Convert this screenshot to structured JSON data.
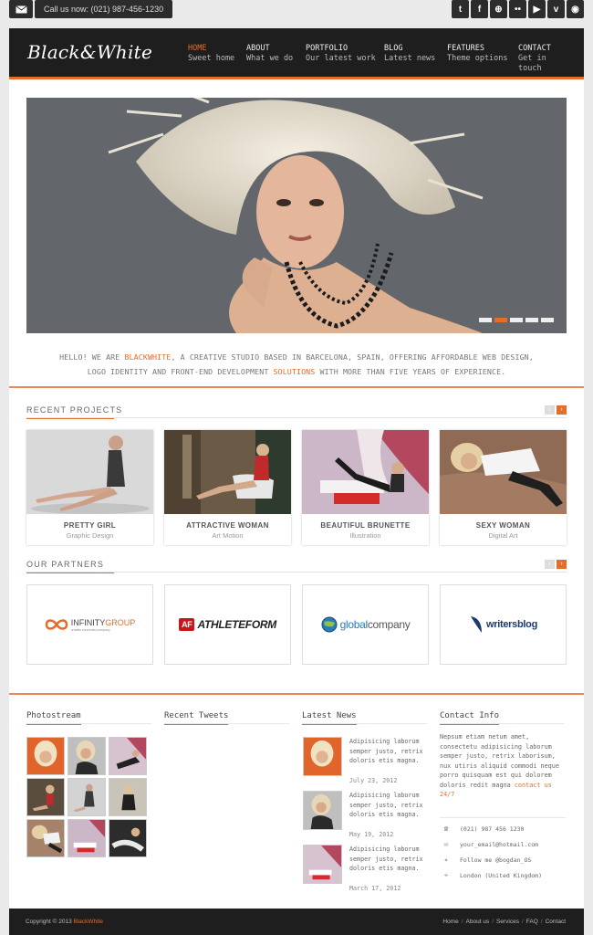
{
  "topbar": {
    "call_text": "Call us now: (021) 987-456-1230",
    "social_icons": [
      "twitter-icon",
      "facebook-icon",
      "dribbble-icon",
      "flickr-icon",
      "youtube-icon",
      "vimeo-icon",
      "rss-icon"
    ],
    "social_glyphs": [
      "t",
      "f",
      "⊕",
      "••",
      "▶",
      "v",
      "◉"
    ]
  },
  "header": {
    "logo": "Black&White",
    "nav": [
      {
        "title": "HOME",
        "subtitle": "Sweet home",
        "active": true
      },
      {
        "title": "ABOUT",
        "subtitle": "What we do"
      },
      {
        "title": "PORTFOLIO",
        "subtitle": "Our latest work"
      },
      {
        "title": "BLOG",
        "subtitle": "Latest news"
      },
      {
        "title": "FEATURES",
        "subtitle": "Theme options"
      },
      {
        "title": "CONTACT",
        "subtitle": "Get in touch"
      }
    ]
  },
  "intro": {
    "p1": "HELLO! WE ARE ",
    "brand": "BLACKWHITE",
    "p2": ", A CREATIVE STUDIO BASED IN BARCELONA, SPAIN, OFFERING AFFORDABLE WEB DESIGN,",
    "p3": "LOGO IDENTITY AND FRONT-END DEVELOPMENT ",
    "solutions": "SOLUTIONS",
    "p4": " WITH MORE THAN FIVE YEARS OF EXPERIENCE."
  },
  "projects": {
    "title": "RECENT PROJECTS",
    "items": [
      {
        "title": "PRETTY GIRL",
        "category": "Graphic Design"
      },
      {
        "title": "ATTRACTIVE WOMAN",
        "category": "Art Motion"
      },
      {
        "title": "BEAUTIFUL BRUNETTE",
        "category": "Illustration"
      },
      {
        "title": "SEXY WOMAN",
        "category": "Digital Art"
      }
    ]
  },
  "partners": {
    "title": "OUR PARTNERS",
    "items": [
      {
        "name": "INFINITYGROUP",
        "name_a": "INFINITY",
        "name_b": "GROUP",
        "tagline": "a better connected company"
      },
      {
        "name": "ATHLETEFORM",
        "badge": "AF"
      },
      {
        "name": "globalcompany",
        "name_a": "global",
        "name_b": "company"
      },
      {
        "name": "writersblog"
      }
    ]
  },
  "footer_cols": {
    "photostream": "Photostream",
    "tweets": "Recent Tweets",
    "news": "Latest News",
    "contact": "Contact Info"
  },
  "news": [
    {
      "text": "Adipisicing laborum semper justo, retrix doloris etis magna.",
      "date": "July 23, 2012"
    },
    {
      "text": "Adipisicing laborum semper justo, retrix doloris etis magna.",
      "date": "May 19, 2012"
    },
    {
      "text": "Adipisicing laborum semper justo, retrix doloris etis magna.",
      "date": "March 17, 2012"
    }
  ],
  "contact": {
    "text": "Nepsum etiam netum amet, consectetu adipisicing laborum semper justo, retrix laborisum, nux utiris aliquid commodi neque porro quisquam est qui dolorem doloris redit magna ",
    "link": "contact us 24/7",
    "phone": "(021) 987 456 1230",
    "email": "your_email@hotmail.com",
    "twitter": "Follow me @bogdan_OS",
    "location": "London (United Kingdom)"
  },
  "footer": {
    "copy_prefix": "Copyright © 2013 ",
    "copy_brand": "BlackWhite",
    "links": [
      "Home",
      "About us",
      "Services",
      "FAQ",
      "Contact"
    ]
  },
  "colors": {
    "accent": "#e36d2b",
    "dark": "#1e1e1e"
  }
}
